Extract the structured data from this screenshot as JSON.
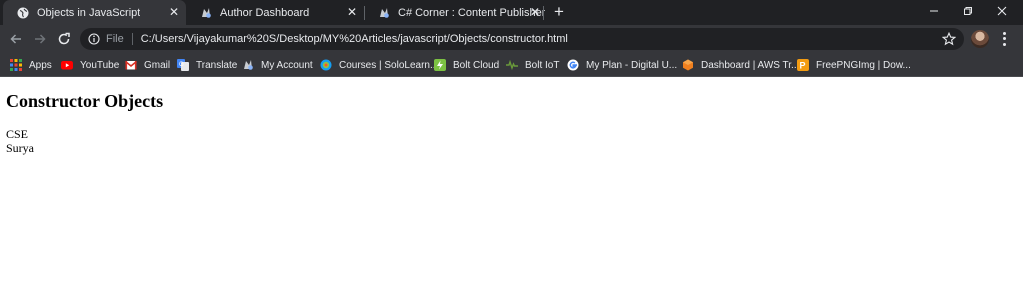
{
  "tabs": [
    {
      "title": "Objects in JavaScript",
      "active": true,
      "icon": "globe-icon"
    },
    {
      "title": "Author Dashboard",
      "active": false,
      "icon": "csharp-corner-icon"
    },
    {
      "title": "C# Corner : Content Publisher",
      "active": false,
      "icon": "csharp-corner-icon"
    }
  ],
  "omnibox": {
    "scheme": "File",
    "url": "C:/Users/Vijayakumar%20S/Desktop/MY%20Articles/javascript/Objects/constructor.html"
  },
  "bookmarks": [
    {
      "label": "Apps",
      "icon": "apps-grid-icon",
      "color": "#ea4335"
    },
    {
      "label": "YouTube",
      "icon": "youtube-icon",
      "color": "#ff0000"
    },
    {
      "label": "Gmail",
      "icon": "gmail-icon",
      "color": "#d93025"
    },
    {
      "label": "Translate",
      "icon": "translate-icon",
      "color": "#4285f4"
    },
    {
      "label": "My Account",
      "icon": "csharp-corner-icon",
      "color": "#9aa0a6"
    },
    {
      "label": "Courses | SoloLearn...",
      "icon": "sololearn-icon",
      "color": "#149ef2"
    },
    {
      "label": "Bolt Cloud",
      "icon": "bolt-cloud-icon",
      "color": "#7cc243"
    },
    {
      "label": "Bolt IoT",
      "icon": "bolt-iot-icon",
      "color": "#6a9a3a"
    },
    {
      "label": "My Plan - Digital U...",
      "icon": "google-icon",
      "color": "#4285f4"
    },
    {
      "label": "Dashboard | AWS Tr...",
      "icon": "aws-icon",
      "color": "#f0801f"
    },
    {
      "label": "FreePNGImg | Dow...",
      "icon": "freepngimg-icon",
      "color": "#f39c12"
    }
  ],
  "content": {
    "heading": "Constructor Objects",
    "lines": [
      "CSE",
      "Surya"
    ]
  }
}
